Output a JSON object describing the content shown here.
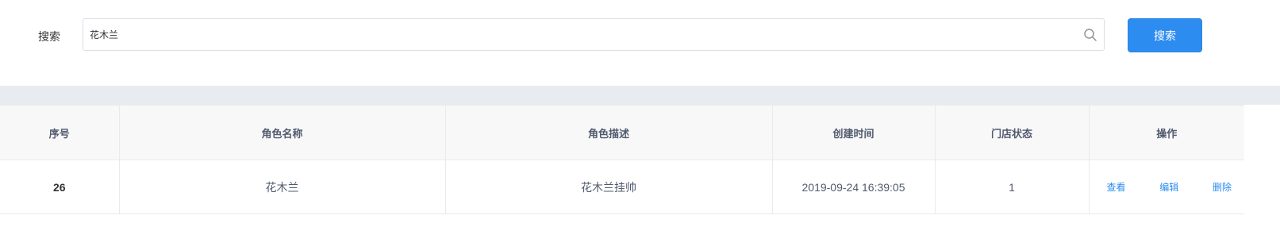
{
  "search": {
    "label": "搜索",
    "value": "花木兰",
    "button_label": "搜索"
  },
  "table": {
    "columns": [
      "序号",
      "角色名称",
      "角色描述",
      "创建时间",
      "门店状态",
      "操作"
    ],
    "rows": [
      {
        "id": "26",
        "name": "花木兰",
        "description": "花木兰挂帅",
        "created_at": "2019-09-24 16:39:05",
        "store_status": "1",
        "actions": {
          "view": "查看",
          "edit": "编辑",
          "delete": "删除"
        }
      }
    ]
  },
  "colors": {
    "primary": "#2d8cf0",
    "header_bg": "#f8f8f9",
    "separator_bg": "#e8ecf0"
  },
  "icons": {
    "search": "search-icon"
  }
}
